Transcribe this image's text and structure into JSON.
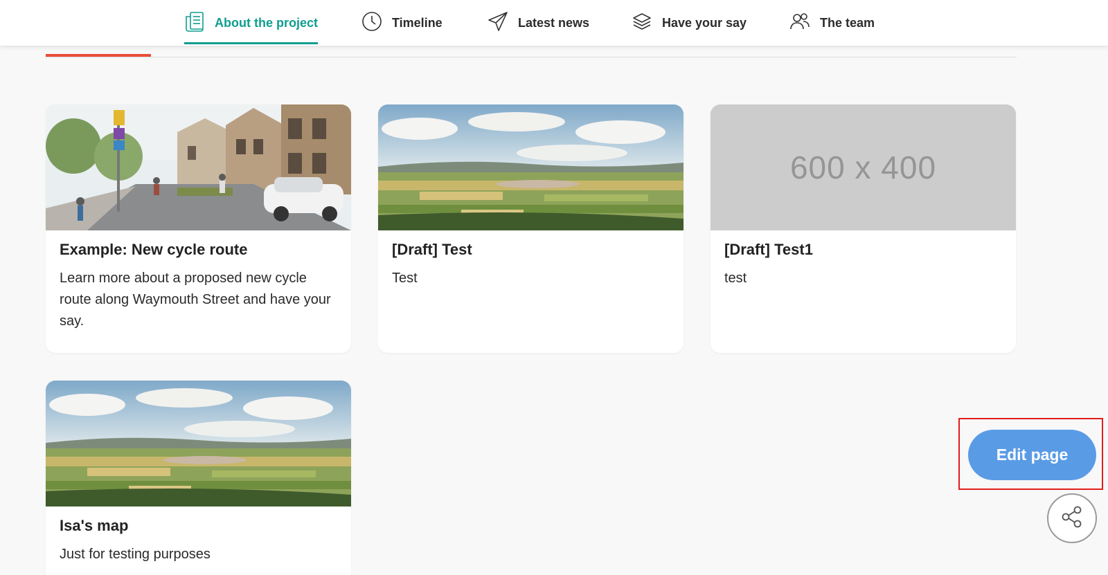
{
  "nav": {
    "items": [
      {
        "label": "About the project",
        "icon": "document-icon",
        "active": true
      },
      {
        "label": "Timeline",
        "icon": "clock-icon",
        "active": false
      },
      {
        "label": "Latest news",
        "icon": "paper-plane-icon",
        "active": false
      },
      {
        "label": "Have your say",
        "icon": "layers-icon",
        "active": false
      },
      {
        "label": "The team",
        "icon": "people-icon",
        "active": false
      }
    ],
    "accent_color": "#0f9d8f"
  },
  "subtabs": {
    "active_indicator_color": "#e94e3a"
  },
  "cards": [
    {
      "title": "Example: New cycle route",
      "description": "Learn more about a proposed new cycle route along Waymouth Street and have your say.",
      "image": "street-cycle-route-image"
    },
    {
      "title": "[Draft] Test",
      "description": "Test",
      "image": "landscape-fields-image"
    },
    {
      "title": "[Draft] Test1",
      "description": "test",
      "image": "placeholder-image",
      "placeholder_text": "600 x 400"
    },
    {
      "title": "Isa's map",
      "description": "Just for testing purposes",
      "image": "landscape-fields-image"
    }
  ],
  "actions": {
    "edit_label": "Edit page",
    "edit_color": "#5a9be6",
    "share_icon": "share-icon"
  }
}
